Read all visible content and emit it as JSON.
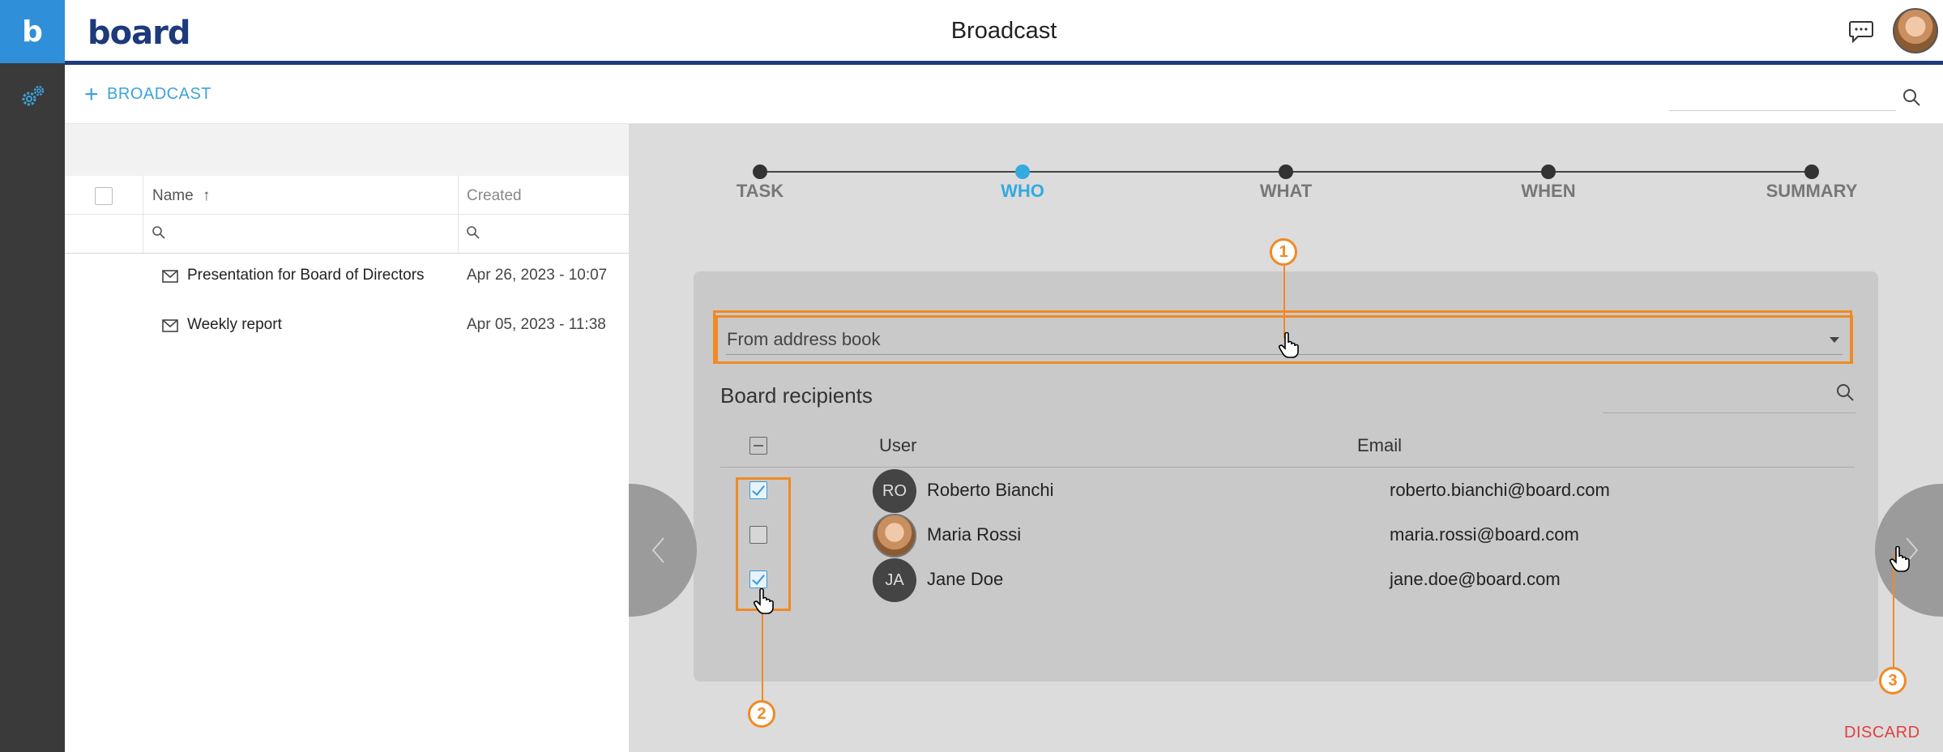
{
  "header": {
    "rail_logo": "b",
    "brand": "board",
    "title": "Broadcast"
  },
  "toolbar": {
    "add_label": "BROADCAST"
  },
  "list": {
    "columns": {
      "name": "Name",
      "sort_indicator": "↑",
      "created": "Created"
    },
    "rows": [
      {
        "name": "Presentation for Board of Directors",
        "created": "Apr 26, 2023 - 10:07"
      },
      {
        "name": "Weekly report",
        "created": "Apr 05, 2023 - 11:38"
      }
    ]
  },
  "wizard": {
    "steps": [
      {
        "label": "TASK",
        "active": false
      },
      {
        "label": "WHO",
        "active": true
      },
      {
        "label": "WHAT",
        "active": false
      },
      {
        "label": "WHEN",
        "active": false
      },
      {
        "label": "SUMMARY",
        "active": false
      }
    ],
    "source_select": {
      "value": "From address book"
    },
    "recipients_title": "Board recipients",
    "table": {
      "user_header": "User",
      "email_header": "Email",
      "rows": [
        {
          "initials": "RO",
          "name": "Roberto Bianchi",
          "email": "roberto.bianchi@board.com",
          "checked": true,
          "photo": false
        },
        {
          "initials": "",
          "name": "Maria Rossi",
          "email": "maria.rossi@board.com",
          "checked": false,
          "photo": true
        },
        {
          "initials": "JA",
          "name": "Jane Doe",
          "email": "jane.doe@board.com",
          "checked": true,
          "photo": false
        }
      ]
    },
    "discard_label": "DISCARD"
  },
  "annotations": {
    "callouts": [
      "1",
      "2",
      "3"
    ],
    "color": "#f08a24"
  },
  "colors": {
    "accent": "#35a9e0",
    "brand_navy": "#1d3a7a",
    "highlight": "#f08a24",
    "danger": "#e04040"
  }
}
